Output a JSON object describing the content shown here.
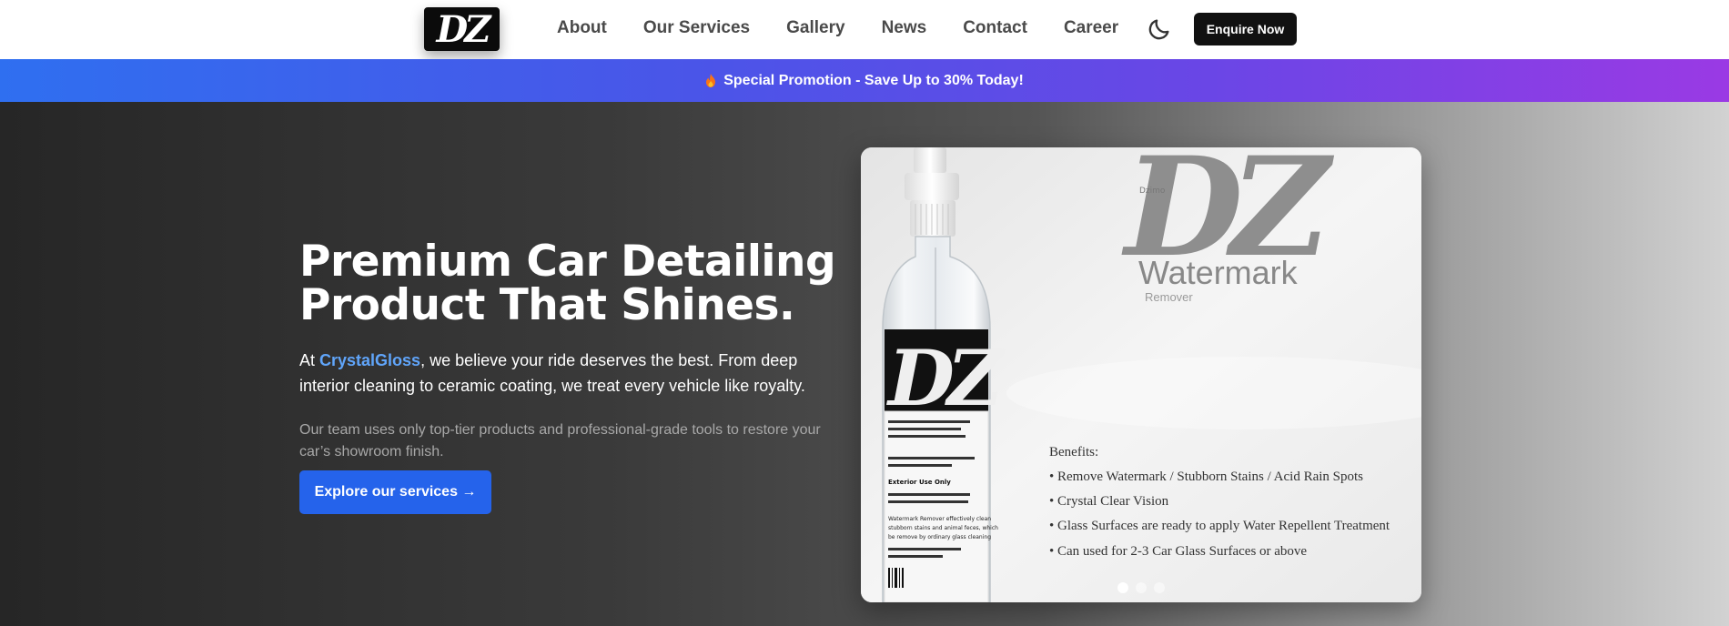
{
  "header": {
    "logo_text": "DZ",
    "nav": [
      "About",
      "Our Services",
      "Gallery",
      "News",
      "Contact",
      "Career"
    ],
    "enquire_label": "Enquire Now",
    "theme_icon": "moon-icon"
  },
  "promo": {
    "icon": "fire-icon",
    "text": "Special Promotion - Save Up to 30% Today!"
  },
  "hero": {
    "title_line1": "Premium Car Detailing",
    "title_line2": "Product That Shines.",
    "para_prefix": "At ",
    "brand": "CrystalGloss",
    "para_suffix": ", we believe your ride deserves the best. From deep interior cleaning to ceramic coating, we treat every vehicle like royalty.",
    "sub": "Our team uses only top-tier products and professional-grade tools to restore your car’s showroom finish.",
    "cta": "Explore our services →"
  },
  "product": {
    "logo_text": "DZ",
    "brand_small": "Dzimo",
    "product_name": "Watermark",
    "product_type": "Remover",
    "bottle_label_text": "DZ",
    "bottle_small_lines": [
      "Exterior Use Only",
      "Watermark Remover effectively clean",
      "stubborn stains and animal feces, which",
      "be remove by ordinary glass cleaning"
    ],
    "benefits_title": "Benefits:",
    "benefits": [
      "• Remove Watermark / Stubborn Stains / Acid Rain Spots",
      "• Crystal Clear Vision",
      "• Glass Surfaces are ready to apply Water Repellent Treatment",
      "• Can used for 2-3 Car Glass Surfaces or above"
    ]
  },
  "carousel": {
    "slides": 3,
    "active_index": 0
  }
}
